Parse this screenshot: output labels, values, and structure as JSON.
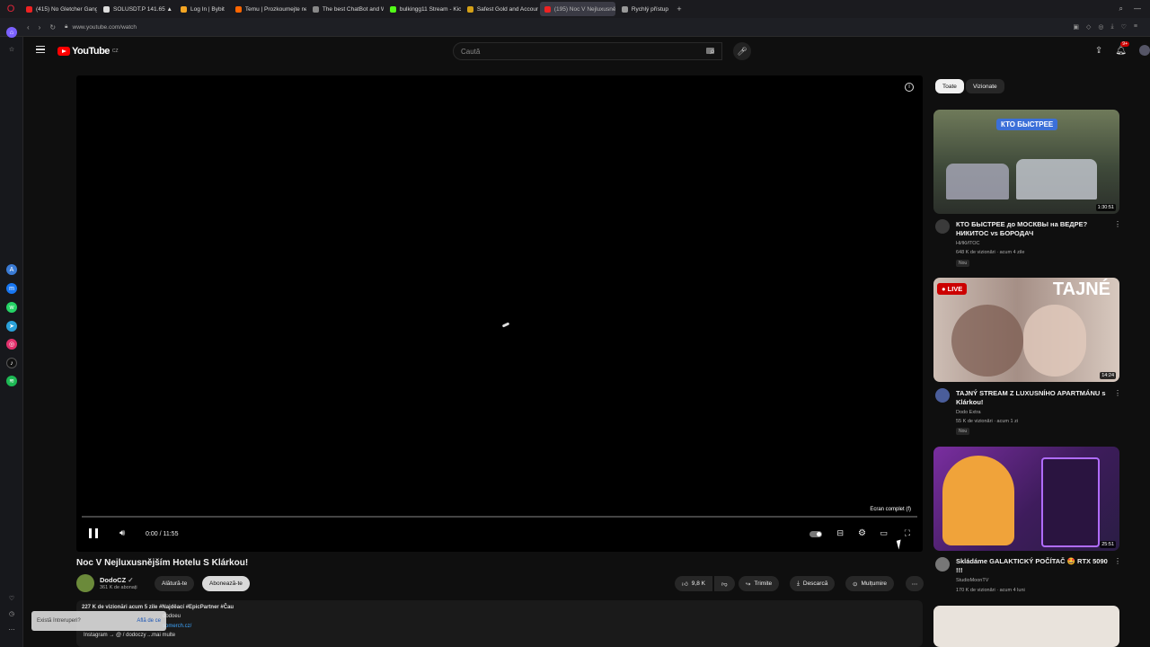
{
  "browser": {
    "tabs": [
      {
        "label": "(415) No Gletcher Gang 2",
        "color": "#e22"
      },
      {
        "label": "SOLUSDT.P 141.65 ▲ +2.2...",
        "color": "#ddd"
      },
      {
        "label": "Log In | Bybit",
        "color": "#f5a623"
      },
      {
        "label": "Temu | Prozkoumejte nej...",
        "color": "#f60"
      },
      {
        "label": "The best ChatBot and Wr...",
        "color": "#888"
      },
      {
        "label": "bulkingg11 Stream - Kick",
        "color": "#53fc18"
      },
      {
        "label": "Safest Gold and Account...",
        "color": "#d4a017"
      },
      {
        "label": "(195) Noc V Nejluxusněj...",
        "color": "#e22",
        "active": true
      },
      {
        "label": "Rychlý přístup",
        "color": "#999"
      }
    ],
    "url": "www.youtube.com/watch"
  },
  "youtube": {
    "logo_text": "YouTube",
    "region": "CZ",
    "search_placeholder": "Caută",
    "notification_count": "9+"
  },
  "player": {
    "time": "0:00 / 11:55",
    "fullscreen_tooltip": "Ecran complet (f)",
    "progress_fraction": 0.0
  },
  "video": {
    "title": "Noc V Nejluxusnějším Hotelu S Klárkou!",
    "channel": "DodoCZ",
    "subscribers": "361 K de abonați",
    "join_label": "Alătură-te",
    "subscribe_label": "Abonează-te",
    "likes": "9,8 K",
    "share_label": "Trimite",
    "download_label": "Descarcă",
    "thanks_label": "Mulțumire",
    "description_line1": "227 K de vizionări  acum 5 zile  #Najděací #EpicPartner #Čau",
    "description_line2": "dodoeu",
    "description_line3": "somerch.cz/",
    "description_line4": "Instagram → @ / dodoczy ...mai multe"
  },
  "toast": {
    "text": "Există întreruperi?",
    "link": "Află de ce"
  },
  "chips": [
    "Toate",
    "Vizionate"
  ],
  "recommendations": [
    {
      "title": "КТО БЫСТРЕЕ до МОСКВЫ на ВЕДРЕ? НИКИТОС vs БОРОДАЧ",
      "channel": "НИКИТОС",
      "meta": "648 K de vizionări · acum 4 zile",
      "badge": "Nou",
      "duration": "1:30:51",
      "thumb_text": "КТО БЫСТРЕЕ",
      "thumb_color": "#5b6b4a"
    },
    {
      "title": "TAJNÝ STREAM Z LUXUSNÍHO APARTMÁNU s Klárkou!",
      "channel": "Dodo Extra",
      "meta": "55 K de vizionări · acum 1 zi",
      "badge": "Nou",
      "duration": "14:24",
      "thumb_text": "TAJNÉ",
      "live_label": "LIVE",
      "thumb_color": "#b9a49a"
    },
    {
      "title": "Skládáme GALAKTICKÝ POČÍTAČ 🤩 RTX 5090 !!!",
      "channel": "StudioMoonTV",
      "meta": "170 K de vizionări · acum 4 luni",
      "duration": "25:51",
      "thumb_color": "#6a2d8c"
    }
  ]
}
